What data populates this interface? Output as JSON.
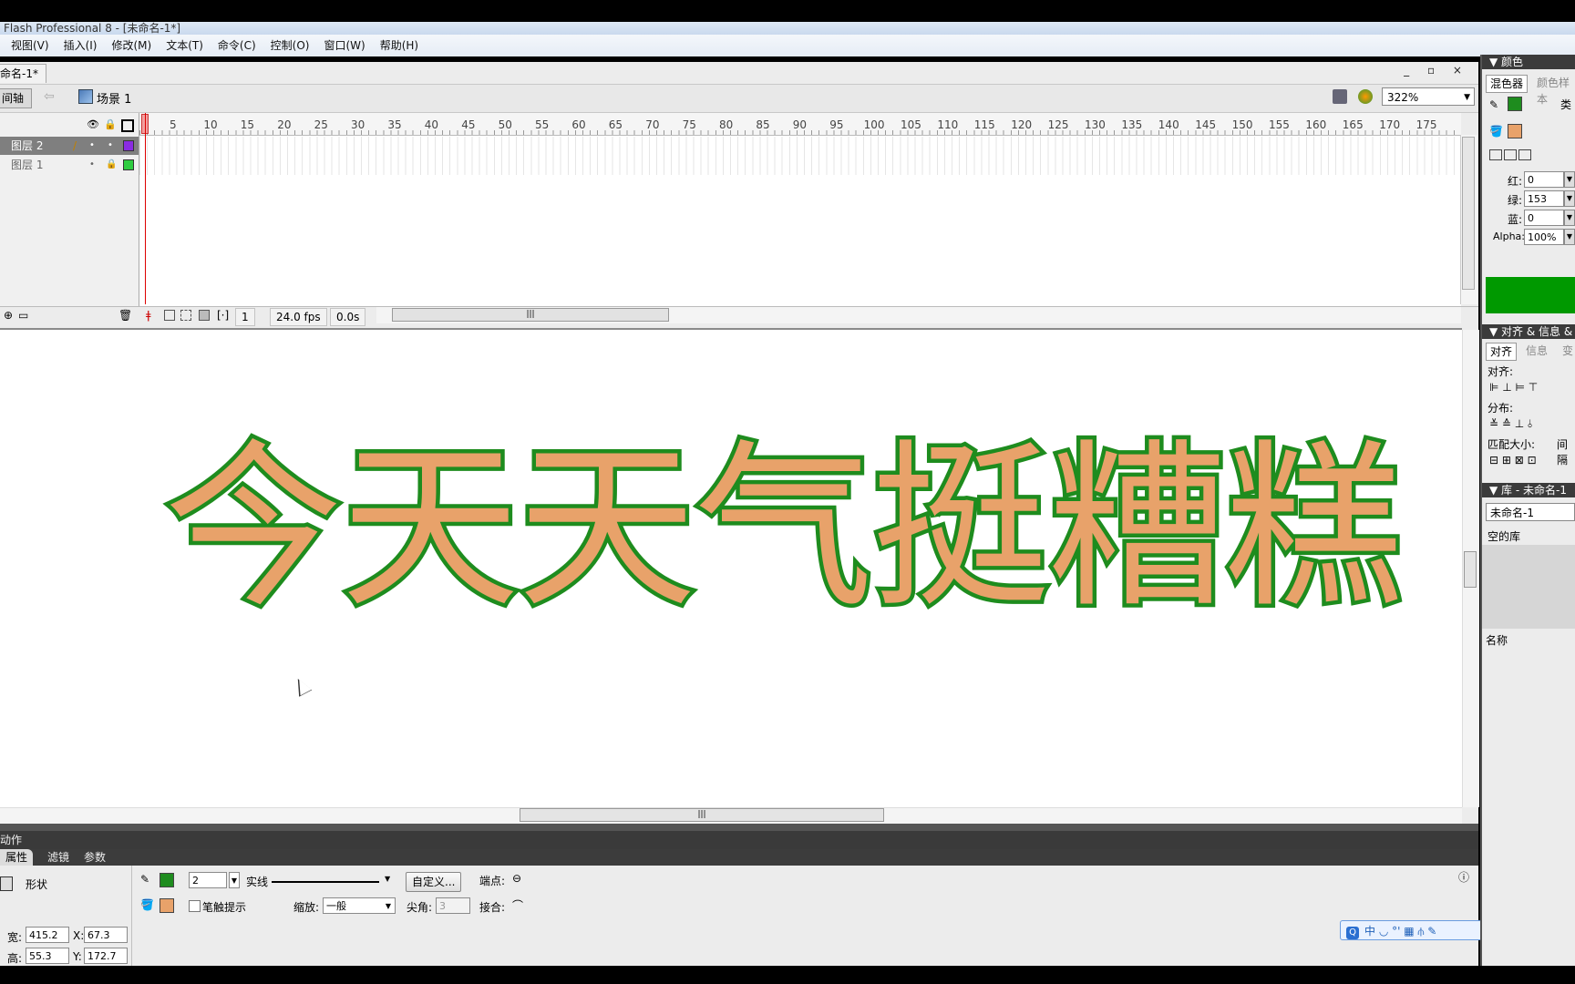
{
  "window": {
    "title": "Flash Professional 8 - [未命名-1*]"
  },
  "menu": [
    "视图(V)",
    "插入(I)",
    "修改(M)",
    "文本(T)",
    "命令(C)",
    "控制(O)",
    "窗口(W)",
    "帮助(H)"
  ],
  "document": {
    "tab": "命名-1*",
    "window_controls": "_ ▫ ×",
    "timeline_button": "间轴",
    "scene": "场景 1",
    "zoom": "322%"
  },
  "timeline": {
    "ruler_ticks": [
      "5",
      "10",
      "15",
      "20",
      "25",
      "30",
      "35",
      "40",
      "45",
      "50",
      "55",
      "60",
      "65",
      "70",
      "75",
      "80",
      "85",
      "90",
      "95",
      "100",
      "105",
      "110",
      "115",
      "120",
      "125",
      "130",
      "135",
      "140",
      "145",
      "150",
      "155",
      "160",
      "165",
      "170",
      "175"
    ],
    "layers": [
      {
        "name": "图层 2",
        "color": "#8a2be2",
        "selected": true
      },
      {
        "name": "图层 1",
        "color": "#2ecc40",
        "selected": false
      }
    ],
    "current_frame": "1",
    "fps": "24.0 fps",
    "time": "0.0s"
  },
  "stage": {
    "text": "今天天气挺糟糕",
    "stroke_color": "#1e8c1e",
    "fill_color": "#e8a26a"
  },
  "panels": {
    "actions": "动作",
    "tabs": [
      "属性",
      "滤镜",
      "参数"
    ]
  },
  "properties": {
    "type": "形状",
    "stroke_height": "2",
    "stroke_style": "实线",
    "custom_button": "自定义...",
    "cap_label": "端点:",
    "hinting_label": "笔触提示",
    "scale_label": "缩放:",
    "scale_value": "一般",
    "miter_label": "尖角:",
    "miter_value": "3",
    "join_label": "接合:",
    "width_label": "宽:",
    "width": "415.2",
    "height_label": "高:",
    "height": "55.3",
    "x_label": "X:",
    "x": "67.3",
    "y_label": "Y:",
    "y": "172.7",
    "stroke_color": "#1e8c1e",
    "fill_color": "#e8a26a"
  },
  "ime": {
    "text": "中 ◡ °' ▦ ⫛ ✎"
  },
  "color_panel": {
    "header": "颜色",
    "tabs": [
      "混色器",
      "颜色样本"
    ],
    "type_label": "类",
    "red_label": "红:",
    "red": "0",
    "green_label": "绿:",
    "green": "153",
    "blue_label": "蓝:",
    "blue": "0",
    "alpha_label": "Alpha:",
    "alpha": "100%",
    "preview": "#009900"
  },
  "align_panel": {
    "header": "对齐 & 信息 &",
    "tabs": [
      "对齐",
      "信息",
      "变"
    ],
    "align_label": "对齐:",
    "distribute_label": "分布:",
    "match_label": "匹配大小:",
    "spacing_label": "间隔"
  },
  "library_panel": {
    "header": "库 - 未命名-1",
    "selector": "未命名-1",
    "empty_label": "空的库",
    "name_col": "名称"
  }
}
